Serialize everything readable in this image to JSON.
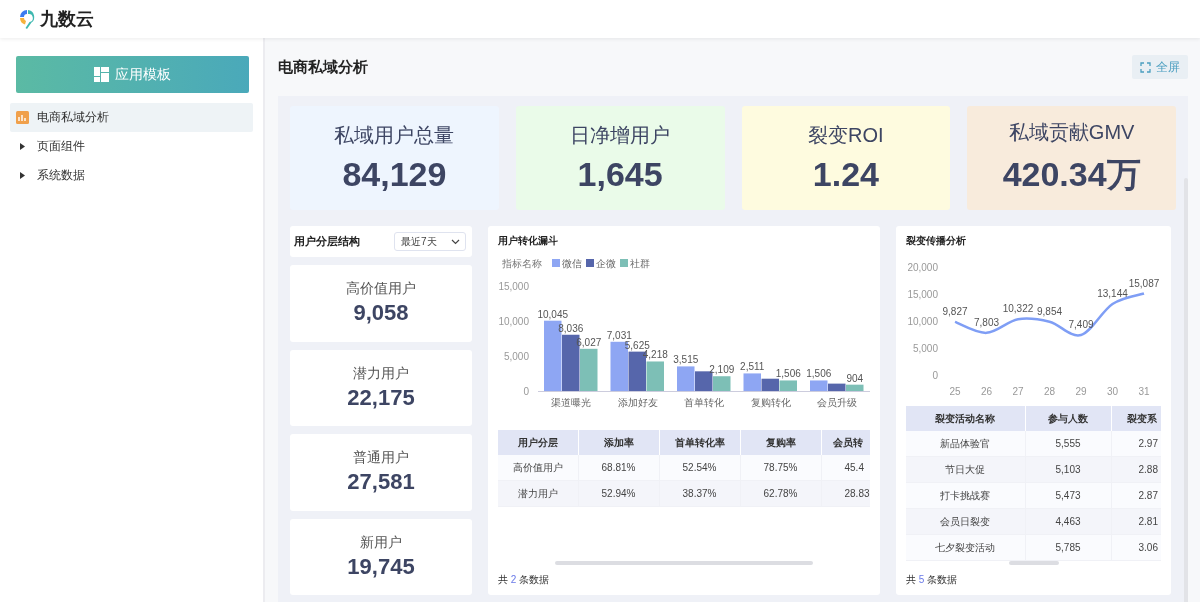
{
  "header": {
    "brand": "九数云"
  },
  "sidebar": {
    "template_button": "应用模板",
    "items": [
      {
        "label": "电商私域分析",
        "kind": "page",
        "selected": true
      },
      {
        "label": "页面组件",
        "kind": "folder",
        "selected": false,
        "expanded": false
      },
      {
        "label": "系统数据",
        "kind": "folder",
        "selected": false,
        "expanded": false
      }
    ]
  },
  "page": {
    "title": "电商私域分析",
    "fullscreen_button": "全屏"
  },
  "kpis": [
    {
      "label": "私域用户总量",
      "value": "84,129",
      "color": "#eef5fe"
    },
    {
      "label": "日净增用户",
      "value": "1,645",
      "color": "#eafbe9"
    },
    {
      "label": "裂变ROI",
      "value": "1.24",
      "color": "#fefbdf"
    },
    {
      "label": "私域贡献GMV",
      "value": "420.34万",
      "color": "#f8ebdc"
    }
  ],
  "segments": {
    "title": "用户分层结构",
    "range": "最近7天",
    "cards": [
      {
        "label": "高价值用户",
        "value": "9,058"
      },
      {
        "label": "潜力用户",
        "value": "22,175"
      },
      {
        "label": "普通用户",
        "value": "27,581"
      },
      {
        "label": "新用户",
        "value": "19,745"
      }
    ]
  },
  "funnel": {
    "legend_title": "指标名称",
    "chart_data": {
      "type": "bar",
      "title": "用户转化漏斗",
      "legend": "top",
      "categories": [
        "渠道曝光",
        "添加好友",
        "首单转化",
        "复购转化",
        "会员升级"
      ],
      "series": [
        {
          "name": "微信",
          "color": "#8ea6f3",
          "values": [
            10045,
            7031,
            3515,
            2511,
            1506
          ]
        },
        {
          "name": "企微",
          "color": "#5666ab",
          "values": [
            8036,
            5625,
            2812,
            1757,
            1054
          ]
        },
        {
          "name": "社群",
          "color": "#7dbfb6",
          "values": [
            6027,
            4218,
            2109,
            1506,
            904
          ]
        }
      ],
      "ylim": [
        0,
        15000
      ],
      "yticks": [
        {
          "value": 0,
          "label": "0"
        },
        {
          "value": 5000,
          "label": "5,000"
        },
        {
          "value": 10000,
          "label": "10,000"
        },
        {
          "value": 15000,
          "label": "15,000"
        }
      ],
      "value_labels": [
        [
          "10,045",
          "7,031",
          "3,515",
          "2,511",
          "1,506"
        ],
        [
          "8,036",
          "5,625",
          null,
          null,
          null
        ],
        [
          "6,027",
          "4,218",
          "2,109",
          "1,506",
          "904"
        ]
      ]
    },
    "table": {
      "columns": [
        "用户分层",
        "添加率",
        "首单转化率",
        "复购率",
        "会员转"
      ],
      "rows": [
        [
          "高价值用户",
          "68.81%",
          "52.54%",
          "78.75%",
          "45.4"
        ],
        [
          "潜力用户",
          "52.94%",
          "38.37%",
          "62.78%",
          "28.83"
        ]
      ]
    },
    "footer": {
      "prefix": "共",
      "count": "2",
      "suffix": "条数据"
    }
  },
  "fission": {
    "chart_data": {
      "type": "line",
      "title": "裂变传播分析",
      "categories": [
        "25",
        "26",
        "27",
        "28",
        "29",
        "30",
        "31"
      ],
      "series": [
        {
          "color": "#7f9ef5",
          "values": [
            9827,
            7803,
            10322,
            9854,
            7409,
            13144,
            15087
          ]
        }
      ],
      "ylim": [
        0,
        20000
      ],
      "yticks": [
        {
          "value": 0,
          "label": "0"
        },
        {
          "value": 5000,
          "label": "5,000"
        },
        {
          "value": 10000,
          "label": "10,000"
        },
        {
          "value": 15000,
          "label": "15,000"
        },
        {
          "value": 20000,
          "label": "20,000"
        }
      ],
      "value_labels": [
        [
          "9,827",
          "7,803",
          "10,322",
          "9,854",
          "7,409",
          "13,144",
          "15,087"
        ]
      ]
    },
    "table": {
      "columns": [
        "裂变活动名称",
        "参与人数",
        "裂变系"
      ],
      "rows": [
        [
          "新品体验官",
          "5,555",
          "2.97"
        ],
        [
          "节日大促",
          "5,103",
          "2.88"
        ],
        [
          "打卡挑战赛",
          "5,473",
          "2.87"
        ],
        [
          "会员日裂变",
          "4,463",
          "2.81"
        ],
        [
          "七夕裂变活动",
          "5,785",
          "3.06"
        ]
      ]
    },
    "footer": {
      "prefix": "共",
      "count": "5",
      "suffix": "条数据"
    }
  }
}
